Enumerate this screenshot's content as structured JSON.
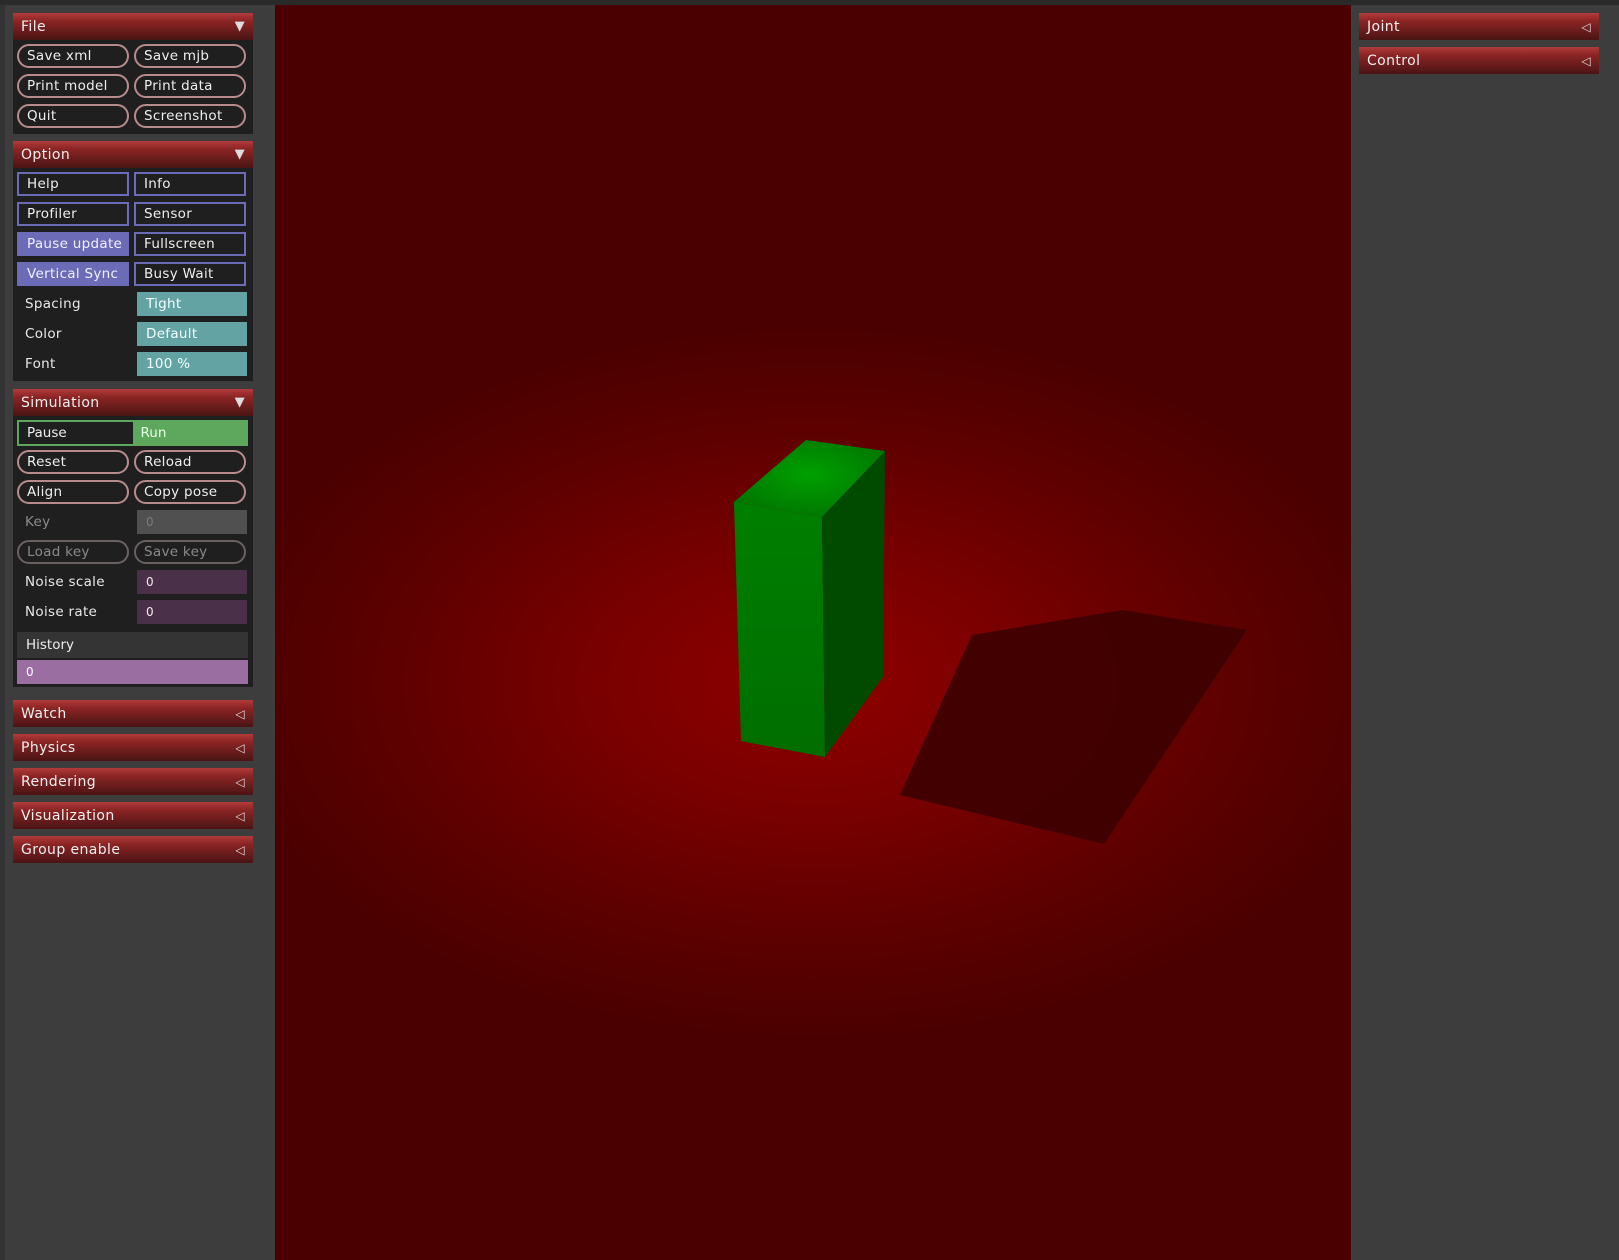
{
  "left_panel": {
    "file": {
      "title": "File",
      "arrow": "▼",
      "buttons": [
        "Save xml",
        "Save mjb",
        "Print model",
        "Print data",
        "Quit",
        "Screenshot"
      ]
    },
    "option": {
      "title": "Option",
      "arrow": "▼",
      "toggles": [
        {
          "label": "Help",
          "active": false
        },
        {
          "label": "Info",
          "active": false
        },
        {
          "label": "Profiler",
          "active": false
        },
        {
          "label": "Sensor",
          "active": false
        },
        {
          "label": "Pause update",
          "active": true
        },
        {
          "label": "Fullscreen",
          "active": false
        },
        {
          "label": "Vertical Sync",
          "active": true
        },
        {
          "label": "Busy Wait",
          "active": false
        }
      ],
      "selects": [
        {
          "label": "Spacing",
          "value": "Tight"
        },
        {
          "label": "Color",
          "value": "Default"
        },
        {
          "label": "Font",
          "value": "100 %"
        }
      ]
    },
    "simulation": {
      "title": "Simulation",
      "arrow": "▼",
      "pause_label": "Pause",
      "run_label": "Run",
      "run_active": true,
      "buttons": [
        "Reset",
        "Reload",
        "Align",
        "Copy pose"
      ],
      "key_label": "Key",
      "key_value": "0",
      "load_key": "Load key",
      "save_key": "Save key",
      "noise_scale_label": "Noise scale",
      "noise_scale_value": "0",
      "noise_rate_label": "Noise rate",
      "noise_rate_value": "0",
      "history_label": "History",
      "history_value": "0"
    },
    "collapsed_sections": [
      {
        "title": "Watch",
        "arrow": "◁"
      },
      {
        "title": "Physics",
        "arrow": "◁"
      },
      {
        "title": "Rendering",
        "arrow": "◁"
      },
      {
        "title": "Visualization",
        "arrow": "◁"
      },
      {
        "title": "Group enable",
        "arrow": "◁"
      }
    ]
  },
  "right_panel": {
    "sections": [
      {
        "title": "Joint",
        "arrow": "◁"
      },
      {
        "title": "Control",
        "arrow": "◁"
      }
    ]
  },
  "viewport": {
    "floor_color": "#7a0000",
    "box_color": "#008000"
  }
}
